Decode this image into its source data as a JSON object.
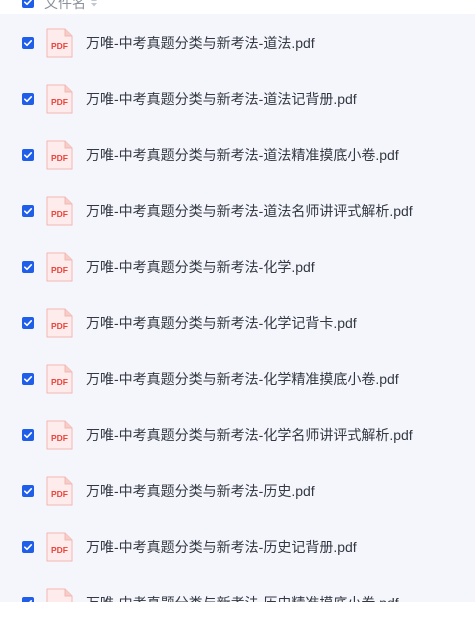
{
  "header": {
    "column_label": "文件名"
  },
  "icons": {
    "file_type": "pdf-file-icon",
    "file_badge": "PDF",
    "checkbox": "checkbox-checked-icon",
    "sort": "sort-icon"
  },
  "colors": {
    "accent": "#1f5ee8",
    "pdf_red": "#e8453c",
    "panel_bg": "#f5f6fc"
  },
  "files": [
    {
      "name": "万唯-中考真题分类与新考法-道法.pdf",
      "checked": true
    },
    {
      "name": "万唯-中考真题分类与新考法-道法记背册.pdf",
      "checked": true
    },
    {
      "name": "万唯-中考真题分类与新考法-道法精准摸底小卷.pdf",
      "checked": true
    },
    {
      "name": "万唯-中考真题分类与新考法-道法名师讲评式解析.pdf",
      "checked": true
    },
    {
      "name": "万唯-中考真题分类与新考法-化学.pdf",
      "checked": true
    },
    {
      "name": "万唯-中考真题分类与新考法-化学记背卡.pdf",
      "checked": true
    },
    {
      "name": "万唯-中考真题分类与新考法-化学精准摸底小卷.pdf",
      "checked": true
    },
    {
      "name": "万唯-中考真题分类与新考法-化学名师讲评式解析.pdf",
      "checked": true
    },
    {
      "name": "万唯-中考真题分类与新考法-历史.pdf",
      "checked": true
    },
    {
      "name": "万唯-中考真题分类与新考法-历史记背册.pdf",
      "checked": true
    },
    {
      "name": "万唯-中考真题分类与新考法-历史精准摸底小卷.pdf",
      "checked": true
    }
  ]
}
